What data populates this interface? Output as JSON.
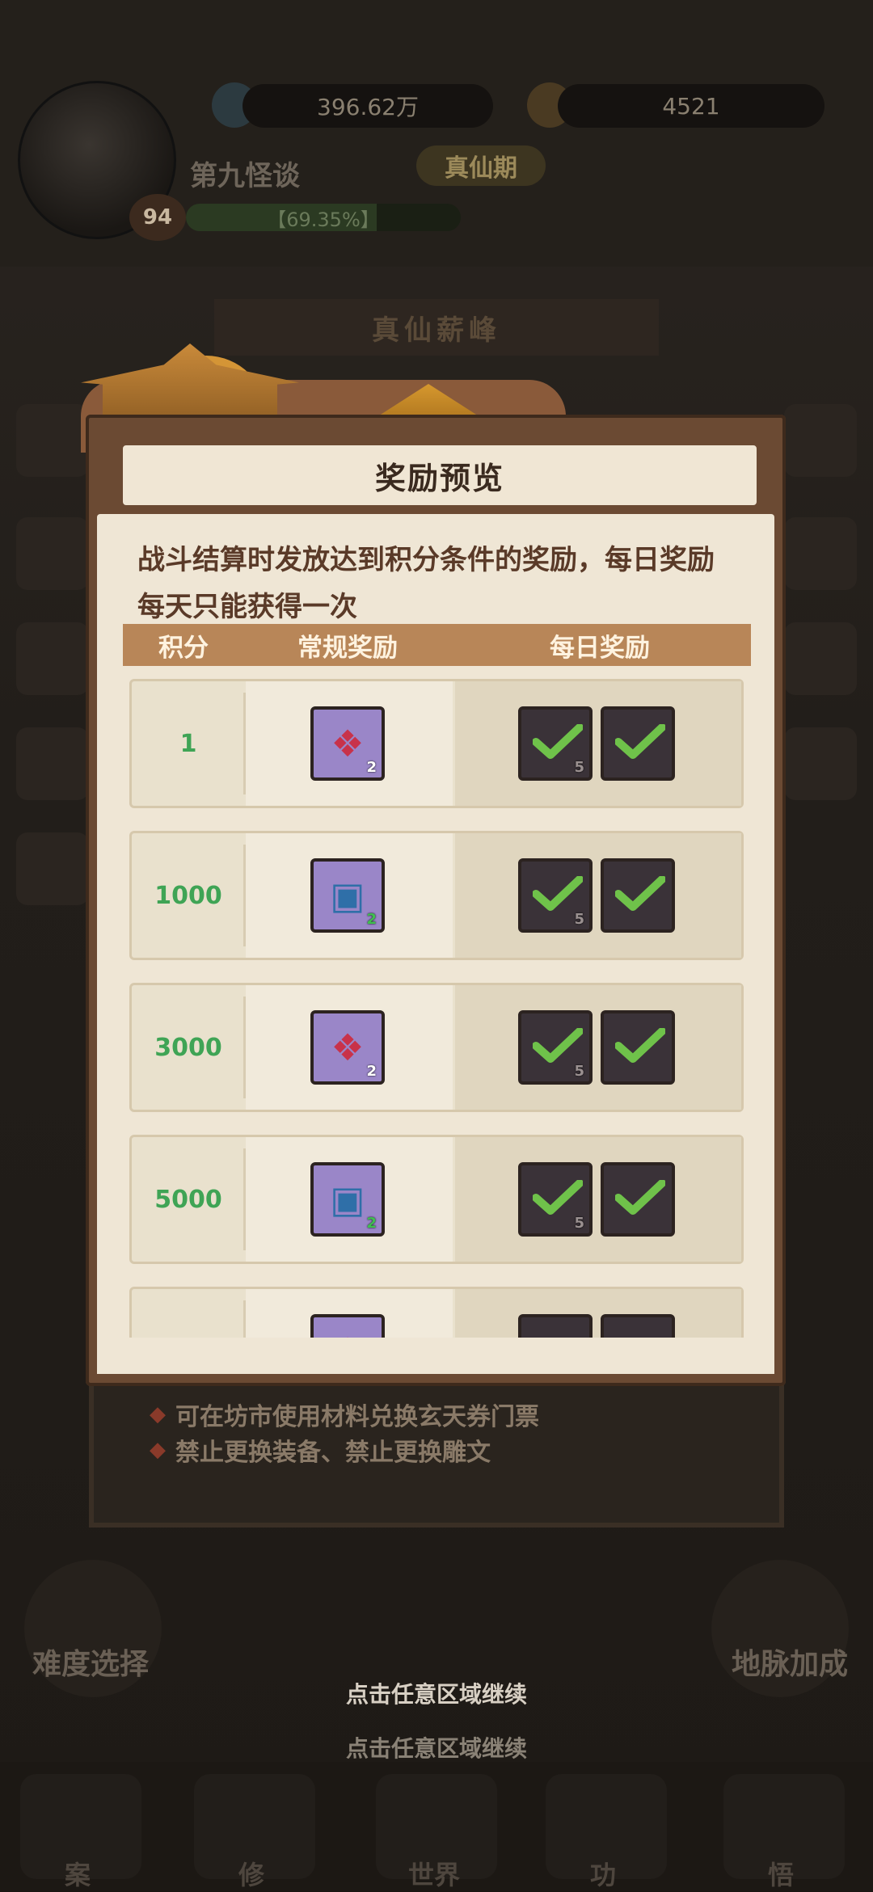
{
  "player": {
    "name": "第九怪谈",
    "level": "94",
    "realm": "真仙期",
    "exp_percent": "【69.35%】",
    "exp_fraction": 0.6935,
    "currency_1": "396.62万",
    "currency_2": "4521"
  },
  "background": {
    "event_title": "真仙薪峰",
    "rules": [
      "可在坊市使用材料兑换玄天券门票",
      "禁止更换装备、禁止更换雕文"
    ],
    "left_button": "难度选择",
    "right_button": "地脉加成",
    "nav": [
      "案",
      "修",
      "世界",
      "功",
      "悟"
    ]
  },
  "modal": {
    "title": "奖励预览",
    "description": "战斗结算时发放达到积分条件的奖励，每日奖励每天只能获得一次",
    "columns": [
      "积分",
      "常规奖励",
      "每日奖励"
    ],
    "rows": [
      {
        "score": "1",
        "normal": {
          "icon": "red-scroll-fan-icon",
          "count": "2"
        },
        "daily": [
          {
            "icon": "dark-fan-item-icon",
            "count": "5",
            "claimed": true
          },
          {
            "icon": "dark-brush-item-icon",
            "claimed": true
          }
        ]
      },
      {
        "score": "1000",
        "normal": {
          "icon": "blue-treasure-chest-icon",
          "count": "2"
        },
        "daily": [
          {
            "icon": "dark-fan-item-icon",
            "count": "5",
            "claimed": true
          },
          {
            "icon": "dark-brush-item-icon",
            "claimed": true
          }
        ]
      },
      {
        "score": "3000",
        "normal": {
          "icon": "red-scroll-fan-icon",
          "count": "2"
        },
        "daily": [
          {
            "icon": "dark-fan-item-icon",
            "count": "5",
            "claimed": true
          },
          {
            "icon": "dark-brush-item-icon",
            "claimed": true
          }
        ]
      },
      {
        "score": "5000",
        "normal": {
          "icon": "blue-treasure-chest-icon",
          "count": "2"
        },
        "daily": [
          {
            "icon": "dark-fan-item-icon",
            "count": "5",
            "claimed": true
          },
          {
            "icon": "dark-brush-item-icon",
            "claimed": true
          }
        ]
      }
    ]
  },
  "continue_hint_1": "点击任意区域继续",
  "continue_hint_2": "点击任意区域继续",
  "colors": {
    "score_text": "#3fa455",
    "check_mark": "#6fc24a",
    "modal_frame": "#6b4a33",
    "table_header": "#b88658"
  }
}
